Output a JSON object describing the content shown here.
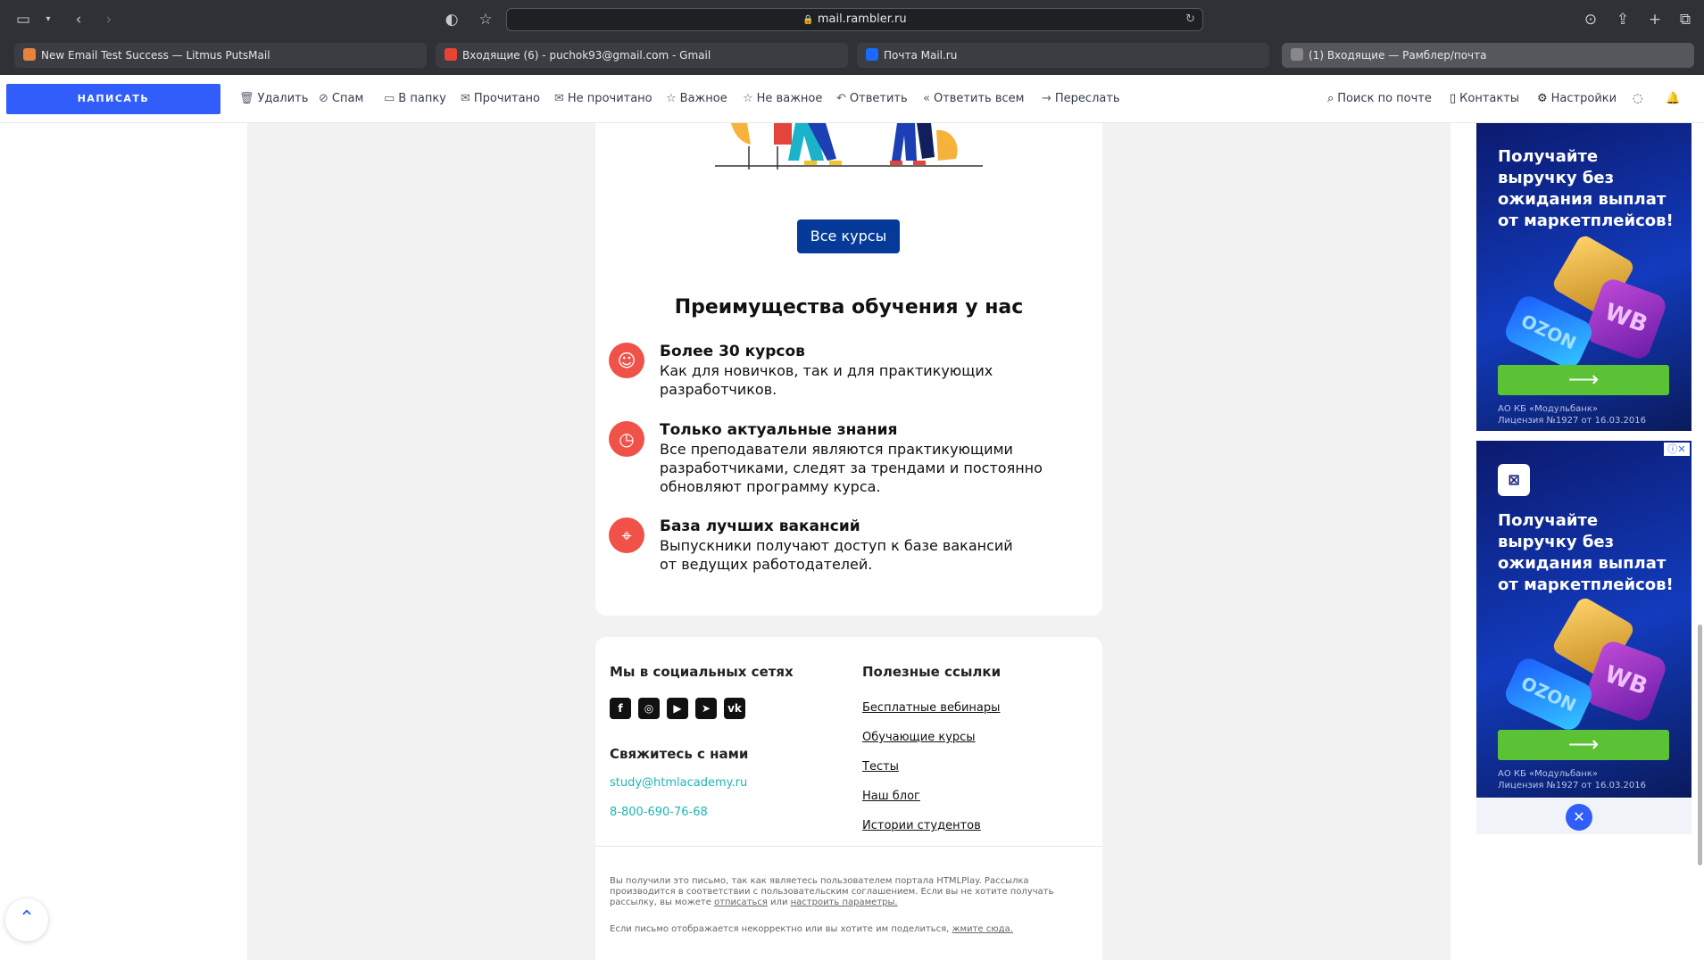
{
  "browser": {
    "url": "mail.rambler.ru",
    "tabs": [
      {
        "label": "New Email Test Success — Litmus PutsMail",
        "fav": "#e8833a"
      },
      {
        "label": "Входящие (6) - puchok93@gmail.com - Gmail",
        "fav": "#ea4335"
      },
      {
        "label": "Почта Mail.ru",
        "fav": "#1a6aff"
      },
      {
        "label": "(1) Входящие — Рамблер/почта",
        "fav": "#888888"
      }
    ]
  },
  "mailbar": {
    "compose": "НАПИСАТЬ",
    "actions": [
      "Удалить",
      "Спам",
      "В папку",
      "Прочитано",
      "Не прочитано",
      "Важное",
      "Не важное",
      "Ответить",
      "Ответить всем",
      "Переслать"
    ],
    "search": "Поиск по почте",
    "contacts": "Контакты",
    "settings": "Настройки"
  },
  "email": {
    "button": "Все курсы",
    "title": "Преимущества обучения у нас",
    "features": [
      {
        "head": "Более 30 курсов",
        "text": "Как для новичков, так и для практикующих разработчиков."
      },
      {
        "head": "Только актуальные знания",
        "text": "Все преподаватели являются практикующими разработчиками, следят за трендами и постоянно обновляют программу курса."
      },
      {
        "head": "База лучших вакансий",
        "text": "Выпускники получают доступ к базе вакансий от ведущих работодателей."
      }
    ],
    "footer": {
      "social_title": "Мы в социальных сетях",
      "contact_title": "Свяжитесь с нами",
      "email": "study@htmlacademy.ru",
      "phone": "8-800-690-76-68",
      "links_title": "Полезные ссылки",
      "links": [
        "Бесплатные вебинары",
        "Обучающие курсы",
        "Тесты",
        "Наш блог",
        "Истории студентов"
      ],
      "legal1_a": "Вы получили это письмо, так как являетесь пользователем портала HTMLPlay. Рассылка производится в соответствии с пользовательским соглашением. Если вы не хотите получать рассылку, вы можете ",
      "legal1_link1": "отписаться",
      "legal1_mid": " или ",
      "legal1_link2": "настроить параметры.",
      "legal2_a": "Если письмо отображается некорректно или вы хотите им поделиться, ",
      "legal2_link": "жмите сюда."
    }
  },
  "ad": {
    "headline": "Получайте выручку без ожидания выплат от маркетплейсов!",
    "cube_wb": "WB",
    "cube_oz": "OZON",
    "arrow": "⟶",
    "small1": "АО КБ «Модульбанк»",
    "small2": "Лицензия №1927 от 16.03.2016"
  },
  "icons": {
    "compose_accent": "#315efb",
    "feature_accent": "#f0524a",
    "contact_accent": "#1fb6b3",
    "button_accent": "#053a98"
  }
}
